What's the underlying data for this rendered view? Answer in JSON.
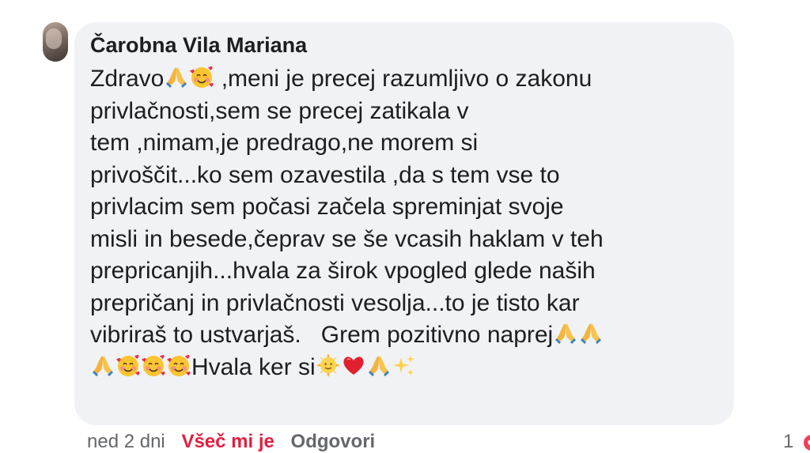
{
  "comment": {
    "author": "Čarobna Vila Mariana",
    "lines": [
      {
        "segs": [
          [
            "t",
            "Zdravo"
          ],
          [
            "e",
            "pray"
          ],
          [
            "e",
            "smiling-hearts"
          ],
          [
            "t",
            " ,meni je precej razumljivo o zakonu"
          ]
        ]
      },
      {
        "segs": [
          [
            "t",
            "privlačnosti,sem se precej zatikala v"
          ]
        ]
      },
      {
        "segs": [
          [
            "t",
            "tem ,nimam,je predrago,ne morem si"
          ]
        ]
      },
      {
        "segs": [
          [
            "t",
            "privoščit...ko sem ozavestila ,da s tem vse to"
          ]
        ]
      },
      {
        "segs": [
          [
            "t",
            "privlacim sem počasi začela spreminjat svoje"
          ]
        ]
      },
      {
        "segs": [
          [
            "t",
            "misli in besede,čeprav se še vcasih haklam v teh"
          ]
        ]
      },
      {
        "segs": [
          [
            "t",
            "prepricanjih...hvala za širok vpogled glede naših"
          ]
        ]
      },
      {
        "segs": [
          [
            "t",
            "prepričanj in privlačnosti vesolja...to je tisto kar"
          ]
        ]
      },
      {
        "segs": [
          [
            "t",
            "vibriraš to ustvarjaš.   Grem pozitivno naprej"
          ],
          [
            "e",
            "pray"
          ],
          [
            "e",
            "pray"
          ]
        ]
      },
      {
        "segs": [
          [
            "e",
            "pray"
          ],
          [
            "e",
            "smiling-hearts"
          ],
          [
            "e",
            "smiling-hearts"
          ],
          [
            "e",
            "smiling-hearts"
          ],
          [
            "t",
            "Hvala ker si"
          ],
          [
            "e",
            "sun-face"
          ],
          [
            "e",
            "red-heart"
          ],
          [
            "e",
            "pray"
          ],
          [
            "e",
            "sparkles"
          ]
        ]
      }
    ]
  },
  "footer": {
    "time": "ned 2 dni",
    "react_label": "Všeč mi je",
    "reply_label": "Odgovori",
    "reaction_count": "1"
  },
  "colors": {
    "bubble": "#f0f2f5",
    "text": "#1c1e21",
    "secondary": "#65676b",
    "react": "#e41e3f"
  }
}
